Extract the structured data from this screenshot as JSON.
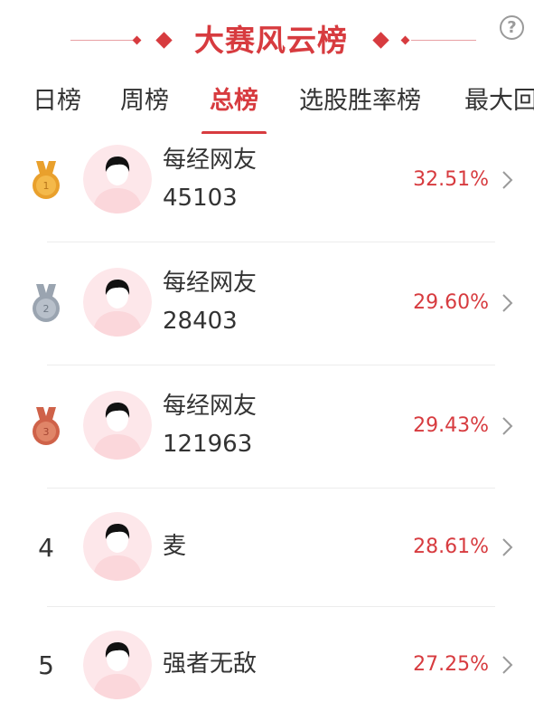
{
  "header": {
    "title": "大赛风云榜",
    "help_label": "?"
  },
  "tabs": [
    {
      "label": "日榜",
      "active": false
    },
    {
      "label": "周榜",
      "active": false
    },
    {
      "label": "总榜",
      "active": true
    },
    {
      "label": "选股胜率榜",
      "active": false
    },
    {
      "label": "最大回",
      "active": false
    }
  ],
  "colors": {
    "accent": "#d73b3f",
    "gold": "#e7a52e",
    "silver": "#a4adb8",
    "bronze": "#d46a4f",
    "avatar_bg": "#fde7ea"
  },
  "ranking": [
    {
      "rank": "1",
      "medal": "gold-medal-icon",
      "name": "每经网友",
      "sub": "45103",
      "rate": "32.51%"
    },
    {
      "rank": "2",
      "medal": "silver-medal-icon",
      "name": "每经网友",
      "sub": "28403",
      "rate": "29.60%"
    },
    {
      "rank": "3",
      "medal": "bronze-medal-icon",
      "name": "每经网友",
      "sub": "121963",
      "rate": "29.43%"
    },
    {
      "rank": "4",
      "medal": null,
      "name": "麦",
      "sub": "",
      "rate": "28.61%"
    },
    {
      "rank": "5",
      "medal": null,
      "name": "强者无敌",
      "sub": "",
      "rate": "27.25%"
    }
  ]
}
